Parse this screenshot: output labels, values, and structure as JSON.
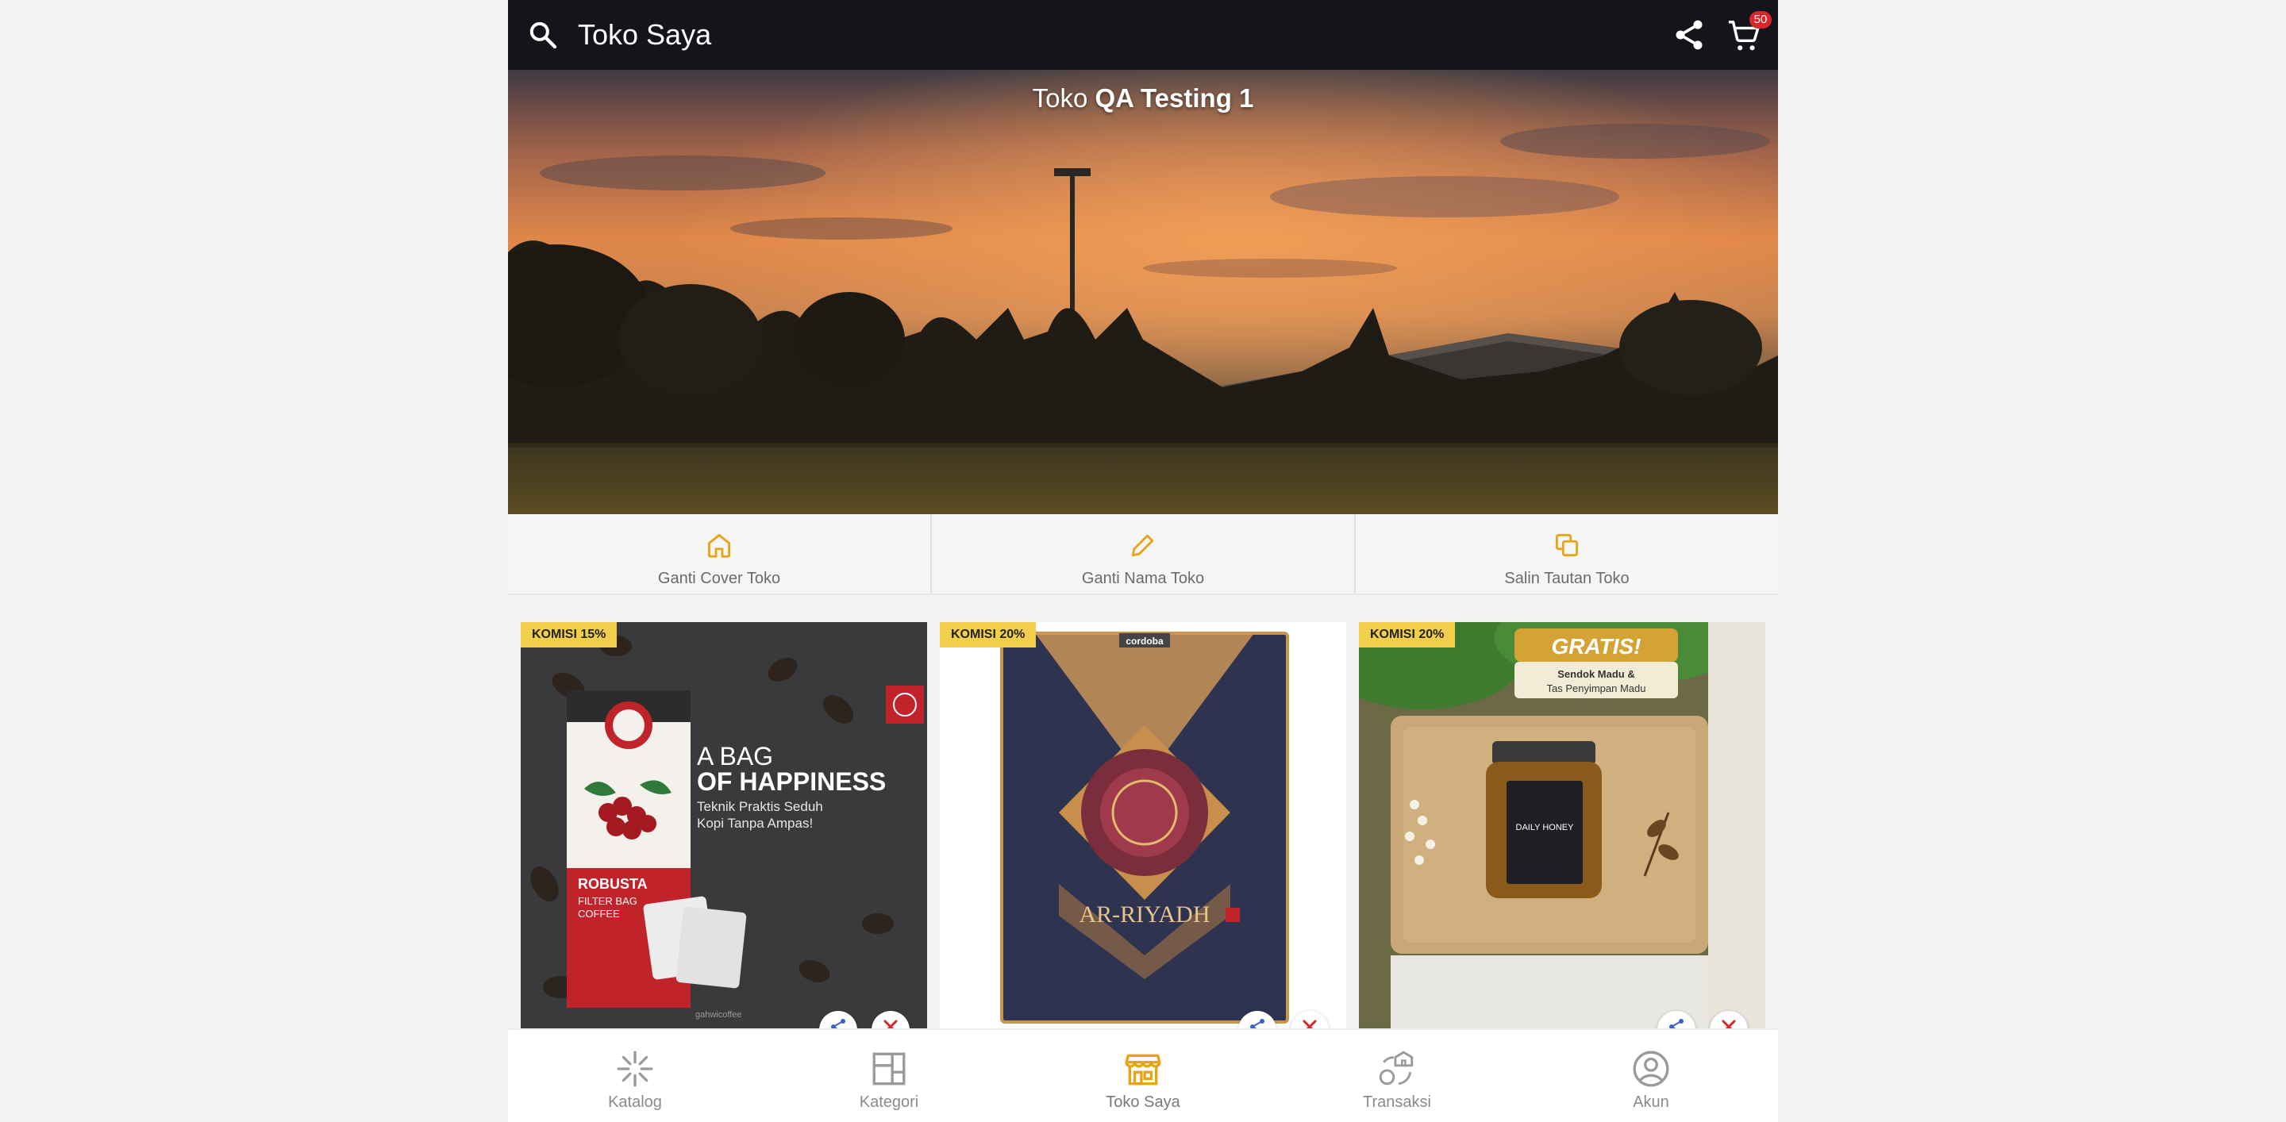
{
  "header": {
    "title": "Toko Saya",
    "cart_count": "50"
  },
  "hero": {
    "prefix": "Toko",
    "store_name": "QA Testing 1"
  },
  "actions": [
    {
      "label": "Ganti Cover Toko",
      "icon": "home-icon"
    },
    {
      "label": "Ganti Nama Toko",
      "icon": "pencil-icon"
    },
    {
      "label": "Salin Tautan Toko",
      "icon": "copy-icon"
    }
  ],
  "products": [
    {
      "commission": "KOMISI 15%",
      "headline_1": "A BAG",
      "headline_2": "OF HAPPINESS",
      "tagline_1": "Teknik Praktis Seduh",
      "tagline_2": "Kopi Tanpa Ampas!",
      "can_label_1": "ROBUSTA",
      "can_label_2": "FILTER BAG",
      "can_label_3": "COFFEE",
      "brand": "gahwicoffee"
    },
    {
      "commission": "KOMISI 20%",
      "publisher": "cordoba",
      "book_title": "AR-RIYADH"
    },
    {
      "commission": "KOMISI 20%",
      "promo_title": "GRATIS!",
      "promo_line_1": "Sendok Madu &",
      "promo_line_2": "Tas Penyimpan Madu",
      "jar_label": "DAILY HONEY"
    }
  ],
  "bottom_nav": [
    {
      "label": "Katalog",
      "icon": "sparkle-icon",
      "active": false
    },
    {
      "label": "Kategori",
      "icon": "layout-icon",
      "active": false
    },
    {
      "label": "Toko Saya",
      "icon": "store-icon",
      "active": true
    },
    {
      "label": "Transaksi",
      "icon": "transaction-icon",
      "active": false
    },
    {
      "label": "Akun",
      "icon": "account-icon",
      "active": false
    }
  ],
  "colors": {
    "accent": "#e8a317",
    "topbar": "#14151a",
    "badge": "#f2cf4a",
    "danger": "#d9262b",
    "share_blue": "#3b63c4"
  }
}
